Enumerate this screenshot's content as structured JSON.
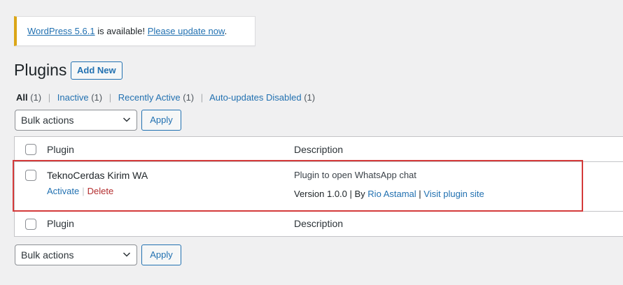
{
  "notice": {
    "version_link": "WordPress 5.6.1",
    "middle_text": " is available! ",
    "update_link": "Please update now",
    "end": "."
  },
  "page": {
    "title": "Plugins",
    "add_new": "Add New"
  },
  "filters": [
    {
      "label": "All",
      "count": "(1)"
    },
    {
      "label": "Inactive",
      "count": "(1)"
    },
    {
      "label": "Recently Active",
      "count": "(1)"
    },
    {
      "label": "Auto-updates Disabled",
      "count": "(1)"
    }
  ],
  "bulk": {
    "select_label": "Bulk actions",
    "apply_label": "Apply"
  },
  "table": {
    "col_plugin": "Plugin",
    "col_description": "Description",
    "rows": [
      {
        "name": "TeknoCerdas Kirim WA",
        "activate": "Activate",
        "delete": "Delete",
        "description": "Plugin to open WhatsApp chat",
        "version": "Version 1.0.0",
        "by_prefix": "By",
        "author": "Rio Astamal",
        "visit": "Visit plugin site"
      }
    ]
  },
  "colors": {
    "accent": "#2271b1",
    "notice_border": "#dba617",
    "delete": "#b32d2e",
    "highlight": "#d43a3a"
  }
}
